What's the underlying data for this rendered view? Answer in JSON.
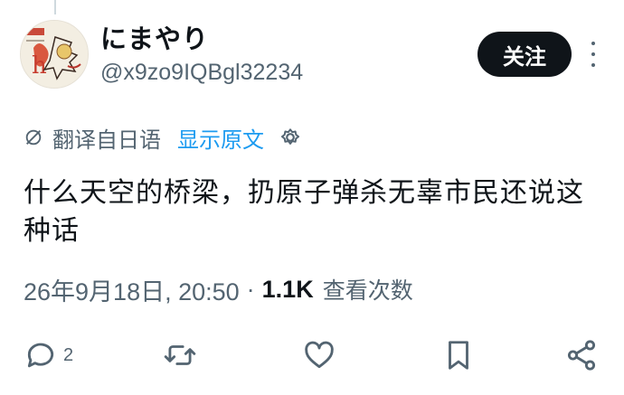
{
  "tweet": {
    "author": {
      "display_name": "にまやり",
      "handle": "@x9zo9IQBgl32234"
    },
    "follow_label": "关注",
    "translation": {
      "label": "翻译自日语",
      "show_original": "显示原文"
    },
    "text": "什么天空的桥梁，扔原子弹杀无辜市民还说这种话",
    "timestamp": "26年9月18日, 20:50",
    "separator": "·",
    "views_count": "1.1K",
    "views_label": "查看次数"
  },
  "actions": {
    "reply_count": "2"
  },
  "icons": {
    "more": "more-vertical-icon",
    "translate": "translate-icon",
    "settings": "gear-icon",
    "reply": "reply-icon",
    "retweet": "retweet-icon",
    "like": "heart-icon",
    "bookmark": "bookmark-icon",
    "share": "share-icon"
  },
  "colors": {
    "text": "#0f1419",
    "secondary": "#536471",
    "link": "#1d9bf0",
    "button_bg": "#0f1419"
  }
}
